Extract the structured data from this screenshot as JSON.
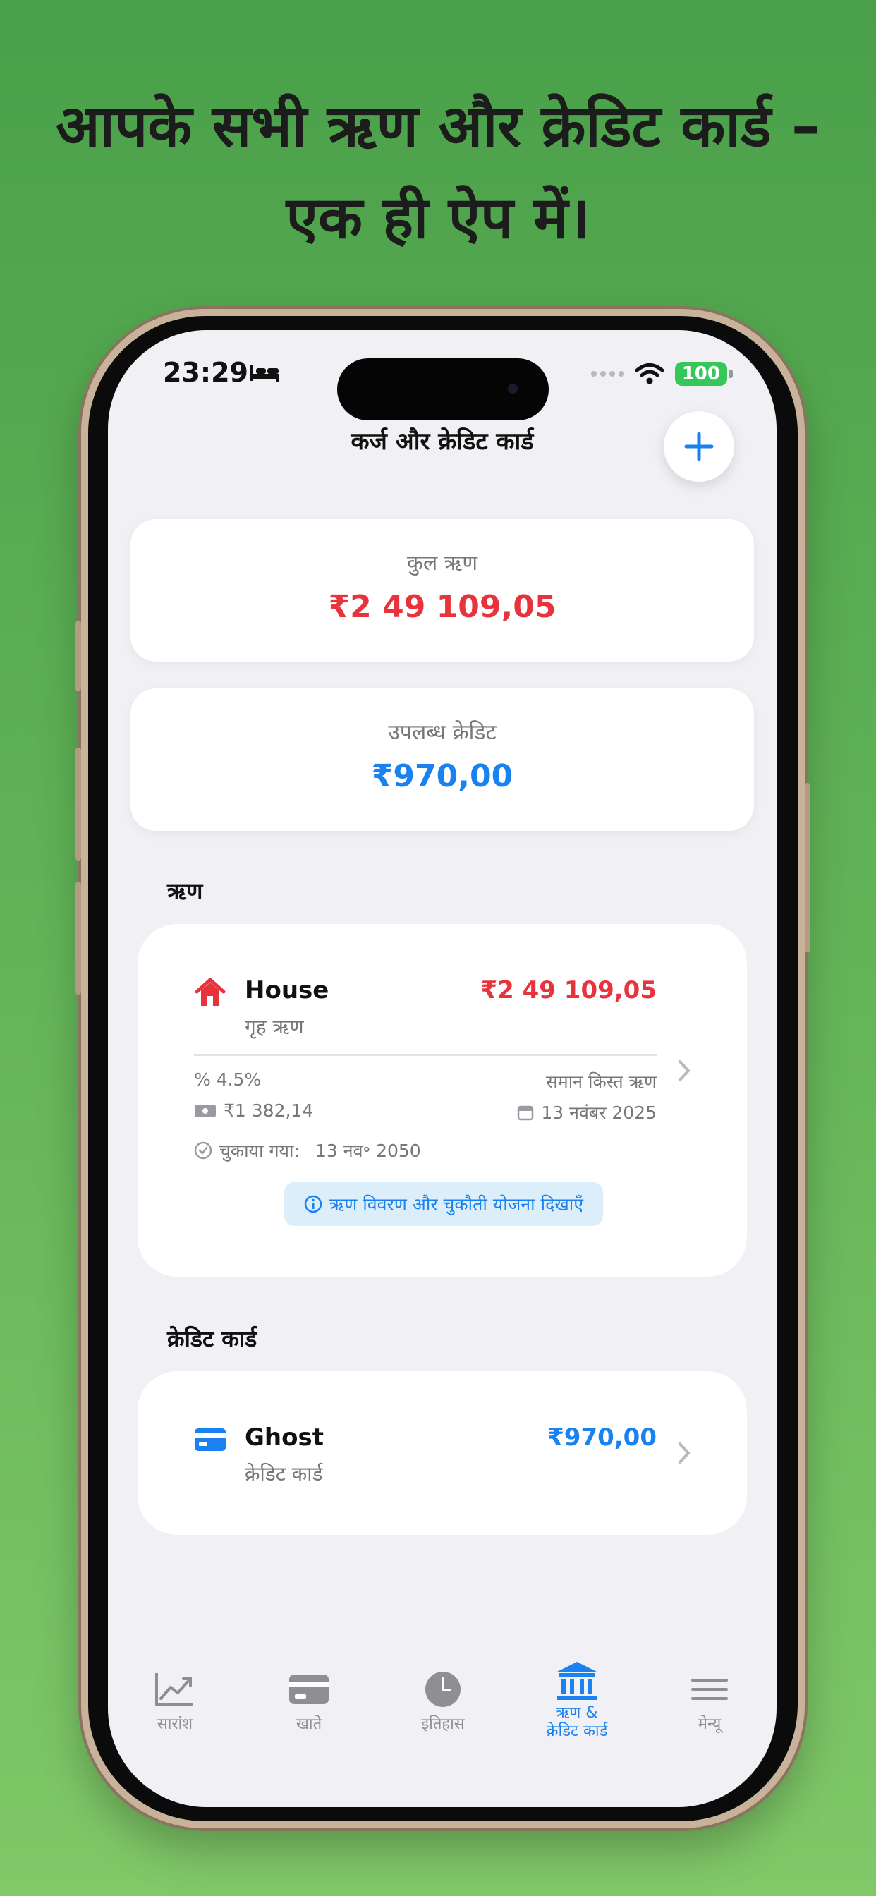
{
  "headline": {
    "line1": "आपके सभी ऋण और क्रेडिट कार्ड –",
    "line2": "एक ही ऐप में।"
  },
  "status_bar": {
    "time": "23:29",
    "battery": "100"
  },
  "nav": {
    "title": "कर्ज और क्रेडिट कार्ड",
    "add_icon": "plus-icon",
    "add_label": "+"
  },
  "summary": {
    "total_debt_label": "कुल ऋण",
    "total_debt_value": "₹2 49 109,05",
    "available_credit_label": "उपलब्ध क्रेडिट",
    "available_credit_value": "₹970,00"
  },
  "loans_section": {
    "title": "ऋण",
    "items": [
      {
        "name": "House",
        "type": "गृह ऋण",
        "amount": "₹2 49 109,05",
        "interest": "% 4.5%",
        "repayment_type": "समान किस्त ऋण",
        "installment": "₹1 382,14",
        "next_date": "13 नवंबर 2025",
        "paid_off_label": "चुकाया गया:",
        "paid_off_date": "13 नव॰ 2050",
        "details_button": "ऋण विवरण और चुकौती योजना दिखाएँ"
      }
    ]
  },
  "cards_section": {
    "title": "क्रेडिट कार्ड",
    "items": [
      {
        "name": "Ghost",
        "type": "क्रेडिट कार्ड",
        "amount": "₹970,00"
      }
    ]
  },
  "tabbar": {
    "tabs": [
      {
        "label": "सारांश",
        "icon": "chart-icon"
      },
      {
        "label": "खाते",
        "icon": "card-icon"
      },
      {
        "label": "इतिहास",
        "icon": "clock-icon"
      },
      {
        "label_line1": "ऋण &",
        "label_line2": "क्रेडिट कार्ड",
        "icon": "bank-icon",
        "active": true
      },
      {
        "label": "मेन्यू",
        "icon": "menu-icon"
      }
    ]
  },
  "colors": {
    "debt_red": "#e8333c",
    "credit_blue": "#1a82f0",
    "background_green": "#5aaa52"
  }
}
